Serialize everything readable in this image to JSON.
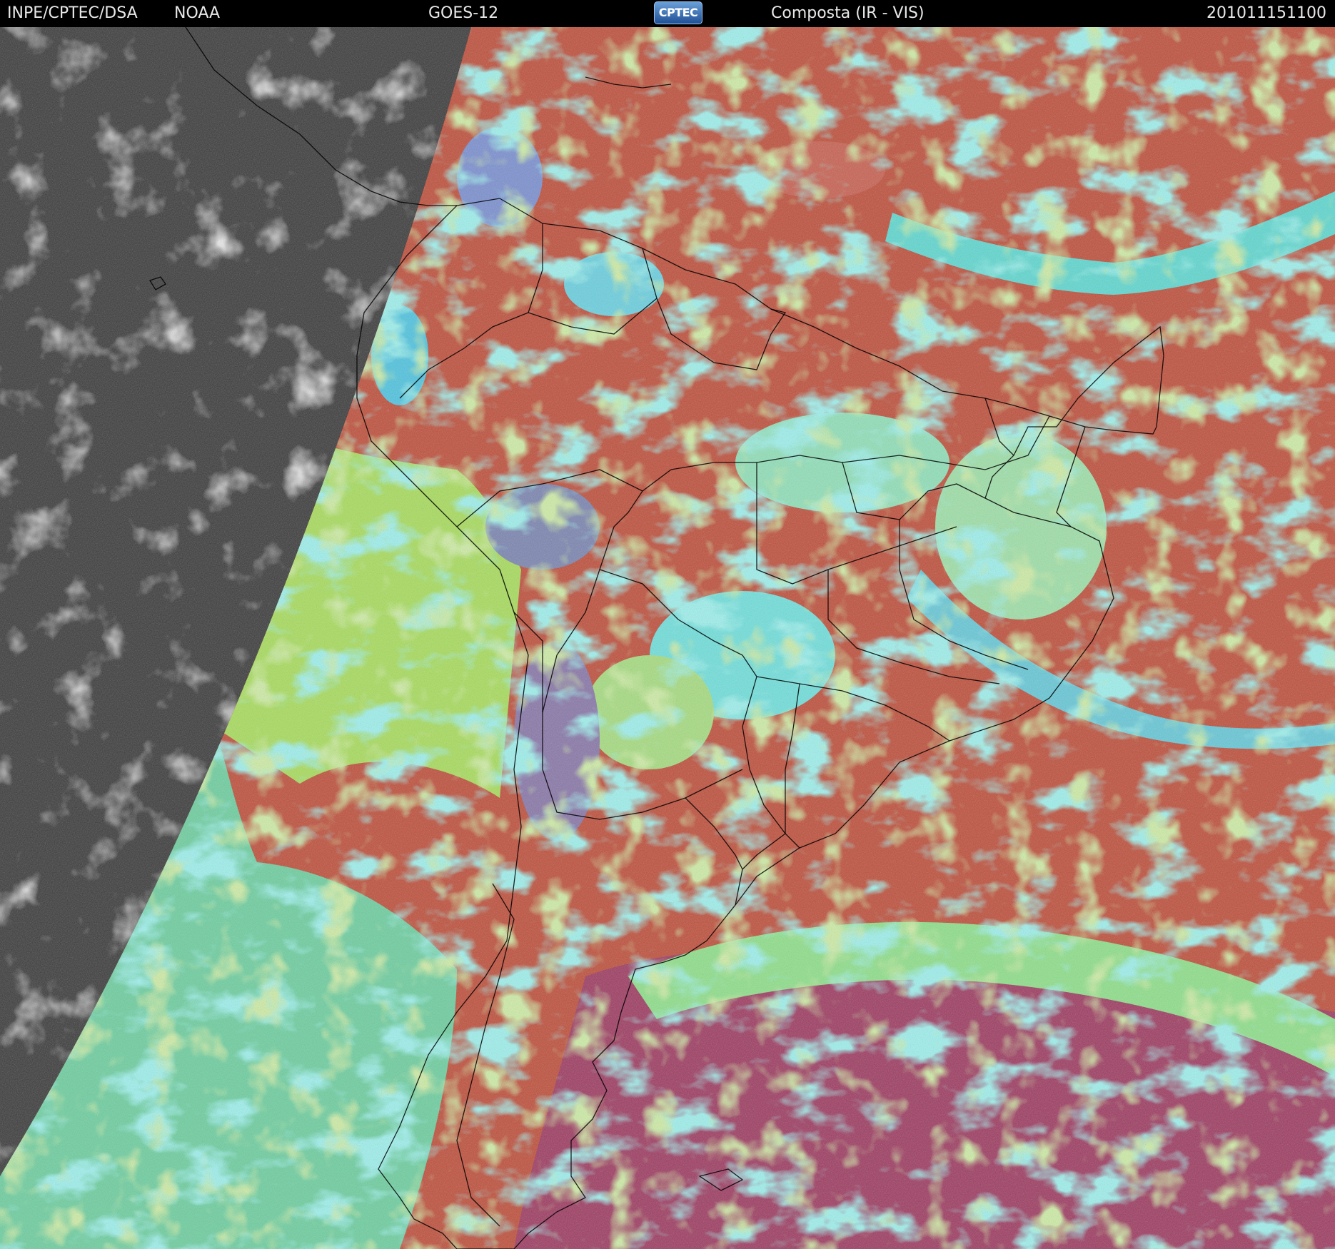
{
  "header": {
    "left_primary": "INPE/CPTEC/DSA",
    "left_secondary": "NOAA",
    "satellite": "GOES-12",
    "logo_text": "CPTEC",
    "product": "Composta (IR - VIS)",
    "timestamp": "201011151100"
  },
  "colors": {
    "header_bg": "#000000",
    "header_text": "#e8e8e8",
    "night_side": "#3a3a3a",
    "land_dry": "#b84a3c",
    "ocean_clear": "#c24a3a",
    "low_cloud": "#9ed860",
    "high_cloud": "#56e0d8",
    "southern_ocean": "#a03a5a",
    "border_lines": "#000000"
  },
  "logo_icon": "cptec-logo"
}
